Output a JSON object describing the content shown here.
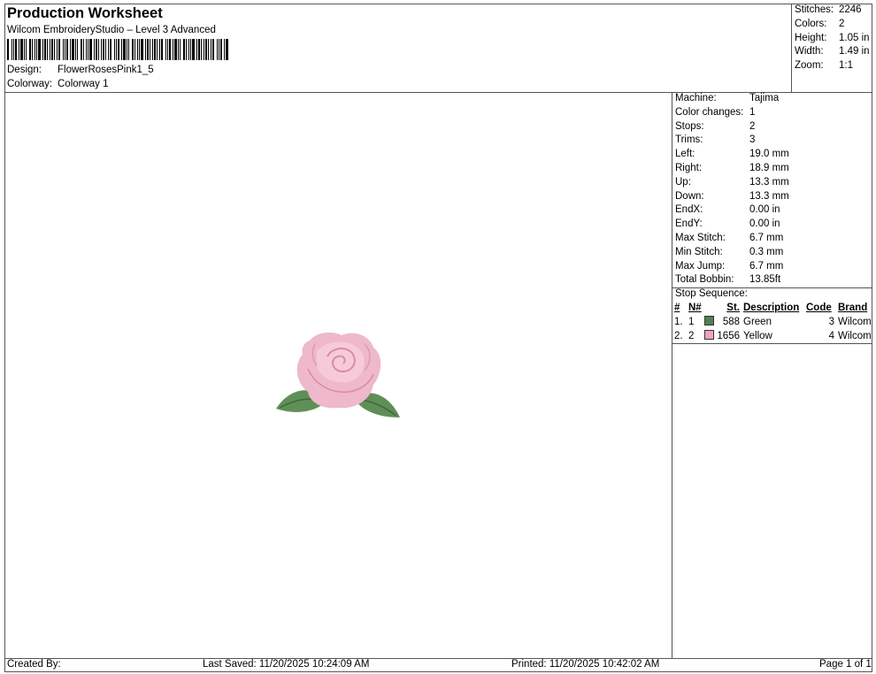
{
  "header": {
    "title": "Production Worksheet",
    "software": "Wilcom EmbroideryStudio – Level 3 Advanced",
    "design_label": "Design:",
    "design_value": "FlowerRosesPink1_5",
    "colorway_label": "Colorway:",
    "colorway_value": "Colorway 1"
  },
  "summary": [
    {
      "label": "Stitches:",
      "value": "2246"
    },
    {
      "label": "Colors:",
      "value": "2"
    },
    {
      "label": "Height:",
      "value": "1.05 in"
    },
    {
      "label": "Width:",
      "value": "1.49 in"
    },
    {
      "label": "Zoom:",
      "value": "1:1"
    }
  ],
  "details": [
    {
      "label": "Machine:",
      "value": "Tajima"
    },
    {
      "label": "Color changes:",
      "value": "1"
    },
    {
      "label": "Stops:",
      "value": "2"
    },
    {
      "label": "Trims:",
      "value": "3"
    },
    {
      "label": "Left:",
      "value": "19.0 mm"
    },
    {
      "label": "Right:",
      "value": "18.9 mm"
    },
    {
      "label": "Up:",
      "value": "13.3 mm"
    },
    {
      "label": "Down:",
      "value": "13.3 mm"
    },
    {
      "label": "EndX:",
      "value": "0.00 in"
    },
    {
      "label": "EndY:",
      "value": "0.00 in"
    },
    {
      "label": "Max Stitch:",
      "value": "6.7 mm"
    },
    {
      "label": "Min Stitch:",
      "value": "0.3 mm"
    },
    {
      "label": "Max Jump:",
      "value": "6.7 mm"
    },
    {
      "label": "Total Bobbin:",
      "value": "13.85ft"
    }
  ],
  "stop_sequence": {
    "title": "Stop Sequence:",
    "headers": {
      "num": "#",
      "n": "N#",
      "st": "St.",
      "desc": "Description",
      "code": "Code",
      "brand": "Brand"
    },
    "rows": [
      {
        "num": "1.",
        "n": "1",
        "color": "#4f7f55",
        "st": "588",
        "desc": "Green",
        "code": "3",
        "brand": "Wilcom"
      },
      {
        "num": "2.",
        "n": "2",
        "color": "#f0a3c4",
        "st": "1656",
        "desc": "Yellow",
        "code": "4",
        "brand": "Wilcom"
      }
    ]
  },
  "footer": {
    "created": "Created By:",
    "saved": "Last Saved: 11/20/2025 10:24:09 AM",
    "printed": "Printed: 11/20/2025 10:42:02 AM",
    "page": "Page 1 of 1"
  }
}
